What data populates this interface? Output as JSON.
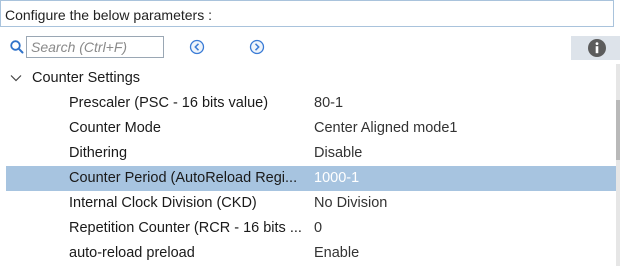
{
  "header": {
    "title": "Configure the below parameters :"
  },
  "search": {
    "placeholder": "Search (Ctrl+F)",
    "value": ""
  },
  "section": {
    "label": "Counter Settings"
  },
  "rows": [
    {
      "name": "Prescaler (PSC - 16 bits value)",
      "value": "80-1"
    },
    {
      "name": "Counter Mode",
      "value": "Center Aligned mode1"
    },
    {
      "name": "Dithering",
      "value": "Disable"
    },
    {
      "name": "Counter Period (AutoReload Regi...",
      "value": "1000-1"
    },
    {
      "name": "Internal Clock Division (CKD)",
      "value": "No Division"
    },
    {
      "name": "Repetition Counter (RCR - 16 bits ...",
      "value": "0"
    },
    {
      "name": "auto-reload preload",
      "value": "Enable"
    }
  ],
  "icons": {
    "search": "search-icon",
    "previous": "previous-icon",
    "next": "next-icon",
    "info": "info-icon",
    "collapse": "chevron-down-icon"
  },
  "colors": {
    "accent": "#3a7bd5",
    "selection": "#a7c4e0",
    "info_bg": "#dde3ea",
    "header_border": "#a9c3dc"
  }
}
